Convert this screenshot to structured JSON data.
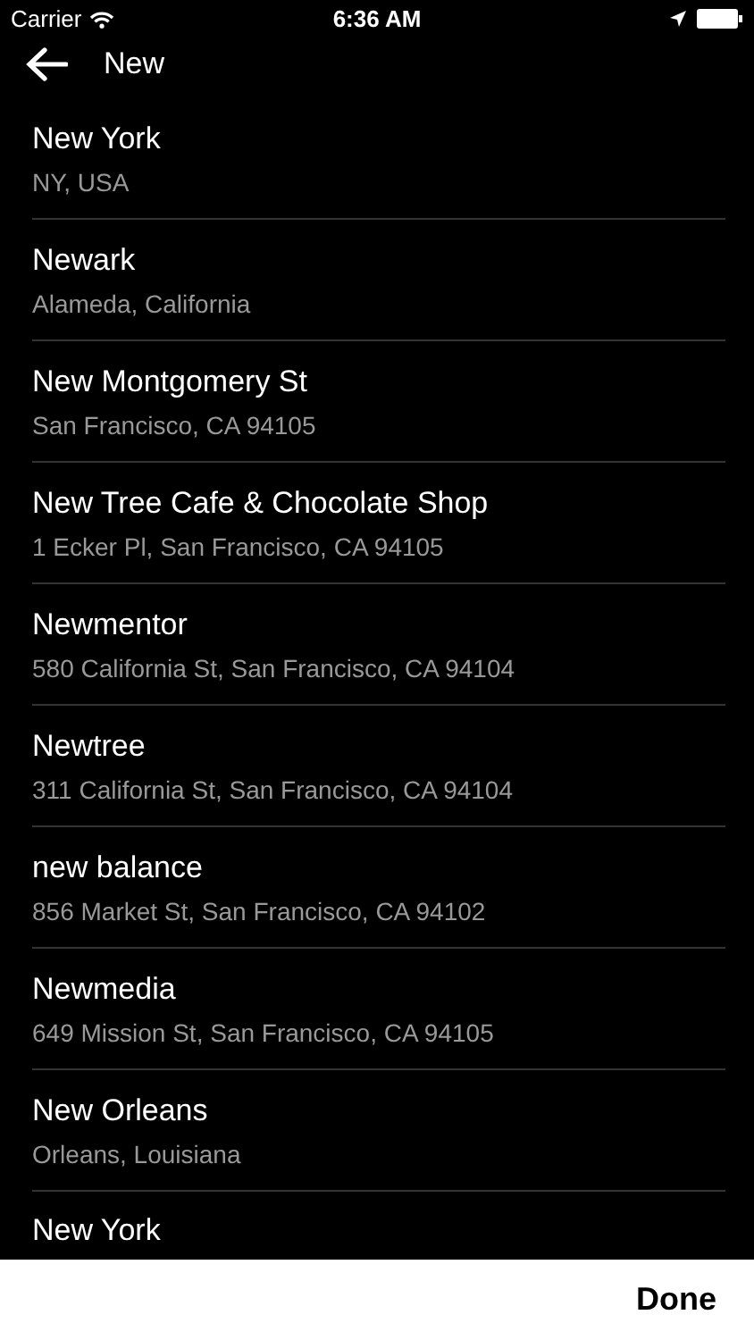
{
  "status_bar": {
    "carrier": "Carrier",
    "time": "6:36 AM"
  },
  "search": {
    "value": "New"
  },
  "results": [
    {
      "title": "New York",
      "subtitle": "NY, USA"
    },
    {
      "title": "Newark",
      "subtitle": "Alameda, California"
    },
    {
      "title": "New Montgomery St",
      "subtitle": "San Francisco, CA 94105"
    },
    {
      "title": "New Tree Cafe & Chocolate Shop",
      "subtitle": "1 Ecker Pl, San Francisco, CA 94105"
    },
    {
      "title": "Newmentor",
      "subtitle": "580 California St, San Francisco, CA 94104"
    },
    {
      "title": "Newtree",
      "subtitle": "311 California St, San Francisco, CA 94104"
    },
    {
      "title": "new balance",
      "subtitle": "856 Market St, San Francisco, CA 94102"
    },
    {
      "title": "Newmedia",
      "subtitle": "649 Mission St, San Francisco, CA 94105"
    },
    {
      "title": "New Orleans",
      "subtitle": "Orleans, Louisiana"
    },
    {
      "title": "New York"
    }
  ],
  "toolbar": {
    "done": "Done"
  }
}
